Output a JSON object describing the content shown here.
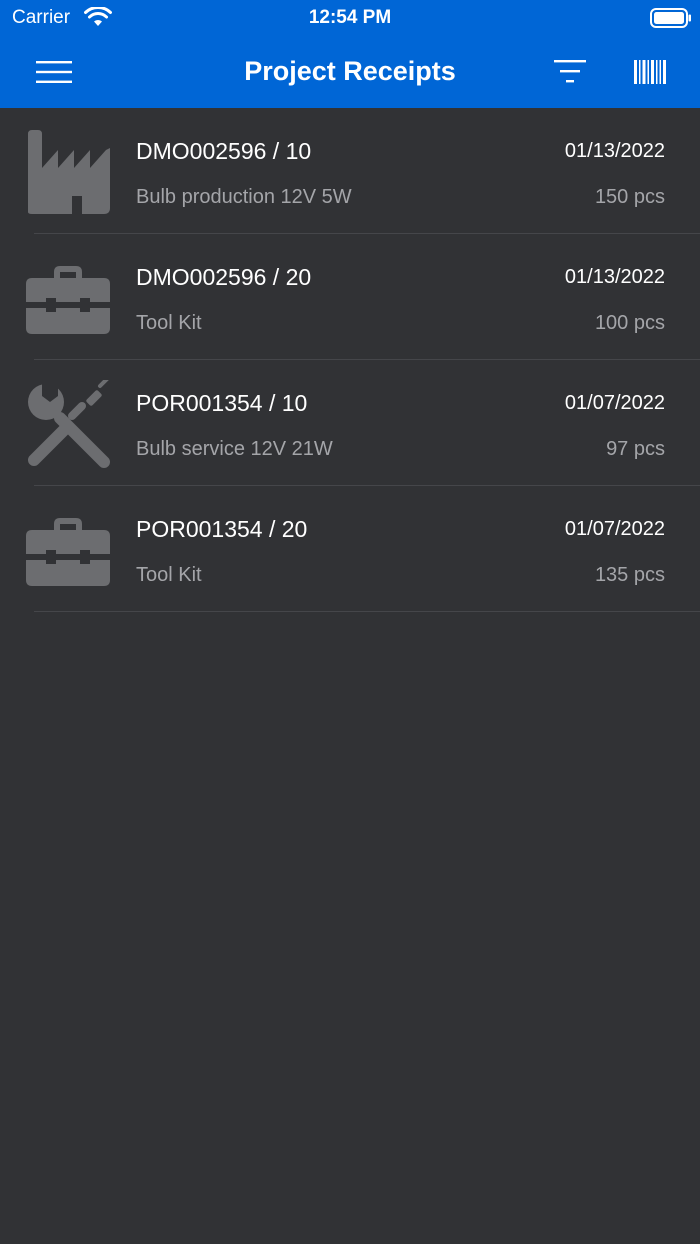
{
  "status_bar": {
    "carrier": "Carrier",
    "time": "12:54 PM"
  },
  "header": {
    "title": "Project Receipts"
  },
  "colors": {
    "header_bg": "#0066D6",
    "background": "#313235",
    "icon": "#6c6d70"
  },
  "receipts": [
    {
      "id": "DMO002596 / 10",
      "date": "01/13/2022",
      "description": "Bulb production 12V 5W",
      "quantity": "150 pcs",
      "icon": "factory-icon"
    },
    {
      "id": "DMO002596 / 20",
      "date": "01/13/2022",
      "description": "Tool Kit",
      "quantity": "100 pcs",
      "icon": "toolbox-icon"
    },
    {
      "id": "POR001354 / 10",
      "date": "01/07/2022",
      "description": "Bulb service 12V 21W",
      "quantity": "97 pcs",
      "icon": "tools-icon"
    },
    {
      "id": "POR001354 / 20",
      "date": "01/07/2022",
      "description": "Tool Kit",
      "quantity": "135 pcs",
      "icon": "toolbox-icon"
    }
  ]
}
